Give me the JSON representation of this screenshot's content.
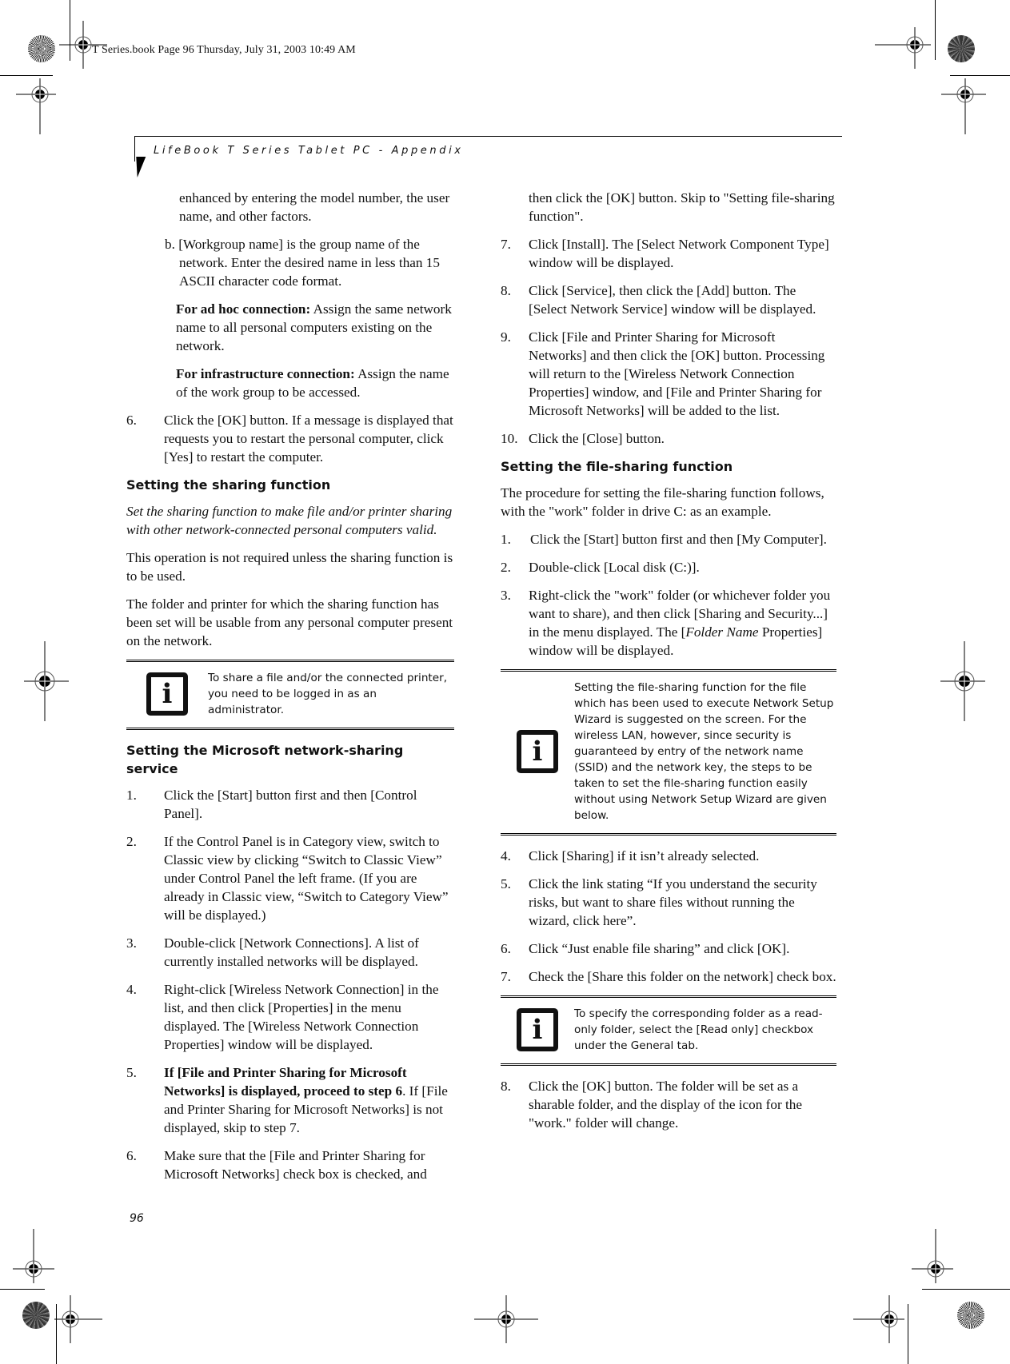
{
  "slug": "T Series.book  Page 96  Thursday, July 31, 2003  10:49 AM",
  "running_header": "LifeBook T Series Tablet PC - Appendix",
  "page_number": "96",
  "left": {
    "para_enhanced": "enhanced by entering the model number, the user name, and other factors.",
    "item_b": "b. [Workgroup name] is the group name of the network. Enter the desired name in less than 15 ASCII character code format.",
    "adhoc_label": "For ad hoc connection:",
    "adhoc_text": " Assign the same network name to all personal computers existing on the network.",
    "infra_label": "For infrastructure connection:",
    "infra_text": " Assign the name of the work group to be accessed.",
    "step6_num": "6.",
    "step6": "Click the [OK] button. If a message is displayed that requests you to restart the personal computer, click [Yes] to restart the computer.",
    "heading_sharing": "Setting the sharing function",
    "sharing_intro": "Set the sharing function to make file and/or printer sharing with other network-connected personal computers valid.",
    "sharing_p1": "This operation is not required unless the sharing function is to be used.",
    "sharing_p2": "The folder and printer for which the sharing function has been set will be usable from any personal computer present on the network.",
    "note1": "To share a file and/or the connected printer, you need to be logged in as an administrator.",
    "heading_ms": "Setting the Microsoft network-sharing service",
    "ms_steps": [
      {
        "num": "1.",
        "text": "Click the [Start] button first and then [Control Panel]."
      },
      {
        "num": "2.",
        "text": "If the Control Panel is in Category view, switch to Classic view by clicking “Switch to Classic View” under Control Panel the left frame. (If you are already in Classic view, “Switch to Category View” will be displayed.)"
      },
      {
        "num": "3.",
        "text": "Double-click [Network Connections]. A list of currently installed networks will be displayed."
      },
      {
        "num": "4.",
        "text": "Right-click [Wireless Network Connection] in the list, and then click [Properties] in the menu displayed. The [Wireless Network Connection Properties] window will be displayed."
      },
      {
        "num": "5.",
        "bold": "If [File and Printer Sharing for Microsoft Networks] is displayed, proceed to step 6",
        "text": ". If [File and Printer Sharing for Microsoft Networks] is not displayed, skip to step 7."
      },
      {
        "num": "6.",
        "text": "Make sure that the [File and Printer Sharing for Microsoft Networks] check box is checked, and"
      }
    ]
  },
  "right": {
    "continuation": "then click the [OK] button. Skip to \"Setting file-sharing function\".",
    "ms_steps_cont": [
      {
        "num": "7.",
        "text": "Click [Install]. The [Select Network Component Type] window will be displayed."
      },
      {
        "num": "8.",
        "text": "Click [Service], then click the [Add] button. The [Select Network Service] window will be displayed."
      },
      {
        "num": "9.",
        "text": "Click [File and Printer Sharing for Microsoft Networks] and then click the [OK] button. Processing will return to the [Wireless Network Connection Properties] window, and [File and Printer Sharing for Microsoft Networks] will be added to the list."
      },
      {
        "num": "10.",
        "text": "Click the [Close] button."
      }
    ],
    "heading_file": "Setting the file-sharing function",
    "file_intro": "The procedure for setting the file-sharing function follows, with the \"work\" folder in drive C: as an example.",
    "file_steps_a": [
      {
        "num": "1.",
        "text": "Click the [Start] button first and then [My Computer]."
      },
      {
        "num": "2.",
        "text": "Double-click [Local disk (C:)]."
      }
    ],
    "step3_num": "3.",
    "step3_a": "Right-click the \"work\" folder (or whichever folder you want to share), and then click [Sharing and Security...] in the menu displayed. The [",
    "step3_italic": "Folder Name",
    "step3_b": " Properties] window will be displayed.",
    "note2": "Setting the file-sharing function for the file which has been used to execute Network Setup Wizard is suggested on the screen. For the wireless LAN, however, since security is guaranteed by entry of the network name (SSID) and the network key, the steps to be taken to set the file-sharing function easily without using Network Setup Wizard are given below.",
    "file_steps_b": [
      {
        "num": "4.",
        "text": "Click [Sharing] if it isn’t already selected."
      },
      {
        "num": "5.",
        "text": "Click the link stating “If you understand the security risks, but want to share files without running the wizard, click here”."
      },
      {
        "num": "6.",
        "text": "Click “Just enable file sharing” and click [OK]."
      },
      {
        "num": "7.",
        "text": "Check the [Share this folder on the network] check box."
      }
    ],
    "note3": "To specify the corresponding folder as a read-only folder, select the [Read only] checkbox under the General tab.",
    "file_step8_num": "8.",
    "file_step8": "Click the [OK] button. The folder will be set as a sharable folder, and the display of the icon for the \"work.\" folder will change."
  },
  "icons": {
    "info": "i"
  }
}
